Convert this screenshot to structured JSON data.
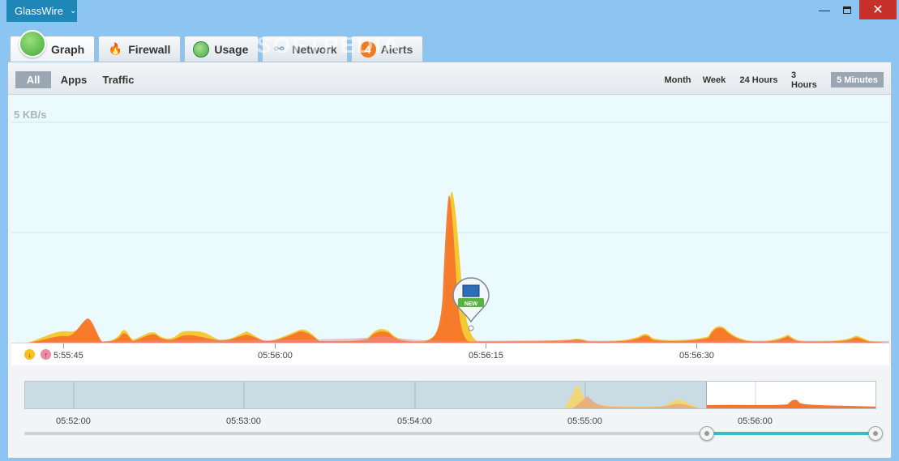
{
  "app": {
    "title": "GlassWire"
  },
  "window": {
    "minimize": "—",
    "close": "✕"
  },
  "tabs": [
    {
      "label": "Graph",
      "icon": "graph-icon"
    },
    {
      "label": "Firewall",
      "icon": "fire-icon"
    },
    {
      "label": "Usage",
      "icon": "usage-icon"
    },
    {
      "label": "Network",
      "icon": "network-icon"
    },
    {
      "label": "Alerts",
      "icon": "alert-icon",
      "badge": "4"
    }
  ],
  "watermark": "SOFTPEDIA",
  "filters": [
    "All",
    "Apps",
    "Traffic"
  ],
  "active_filter": "All",
  "ranges": [
    "Month",
    "Week",
    "24 Hours",
    "3 Hours",
    "5 Minutes"
  ],
  "active_range": "5 Minutes",
  "graph": {
    "ylabel": "5 KB/s",
    "time_ticks": [
      "5:55:45",
      "05:56:00",
      "05:56:15",
      "05:56:30"
    ],
    "marker_badge": "NEW"
  },
  "overview": {
    "time_ticks": [
      "05:52:00",
      "05:53:00",
      "05:54:00",
      "05:55:00",
      "05:56:00"
    ]
  },
  "colors": {
    "incoming": "#f7c21c",
    "outgoing": "#f4772b",
    "accent": "#3bb9c9",
    "brand": "#1f86b8"
  }
}
